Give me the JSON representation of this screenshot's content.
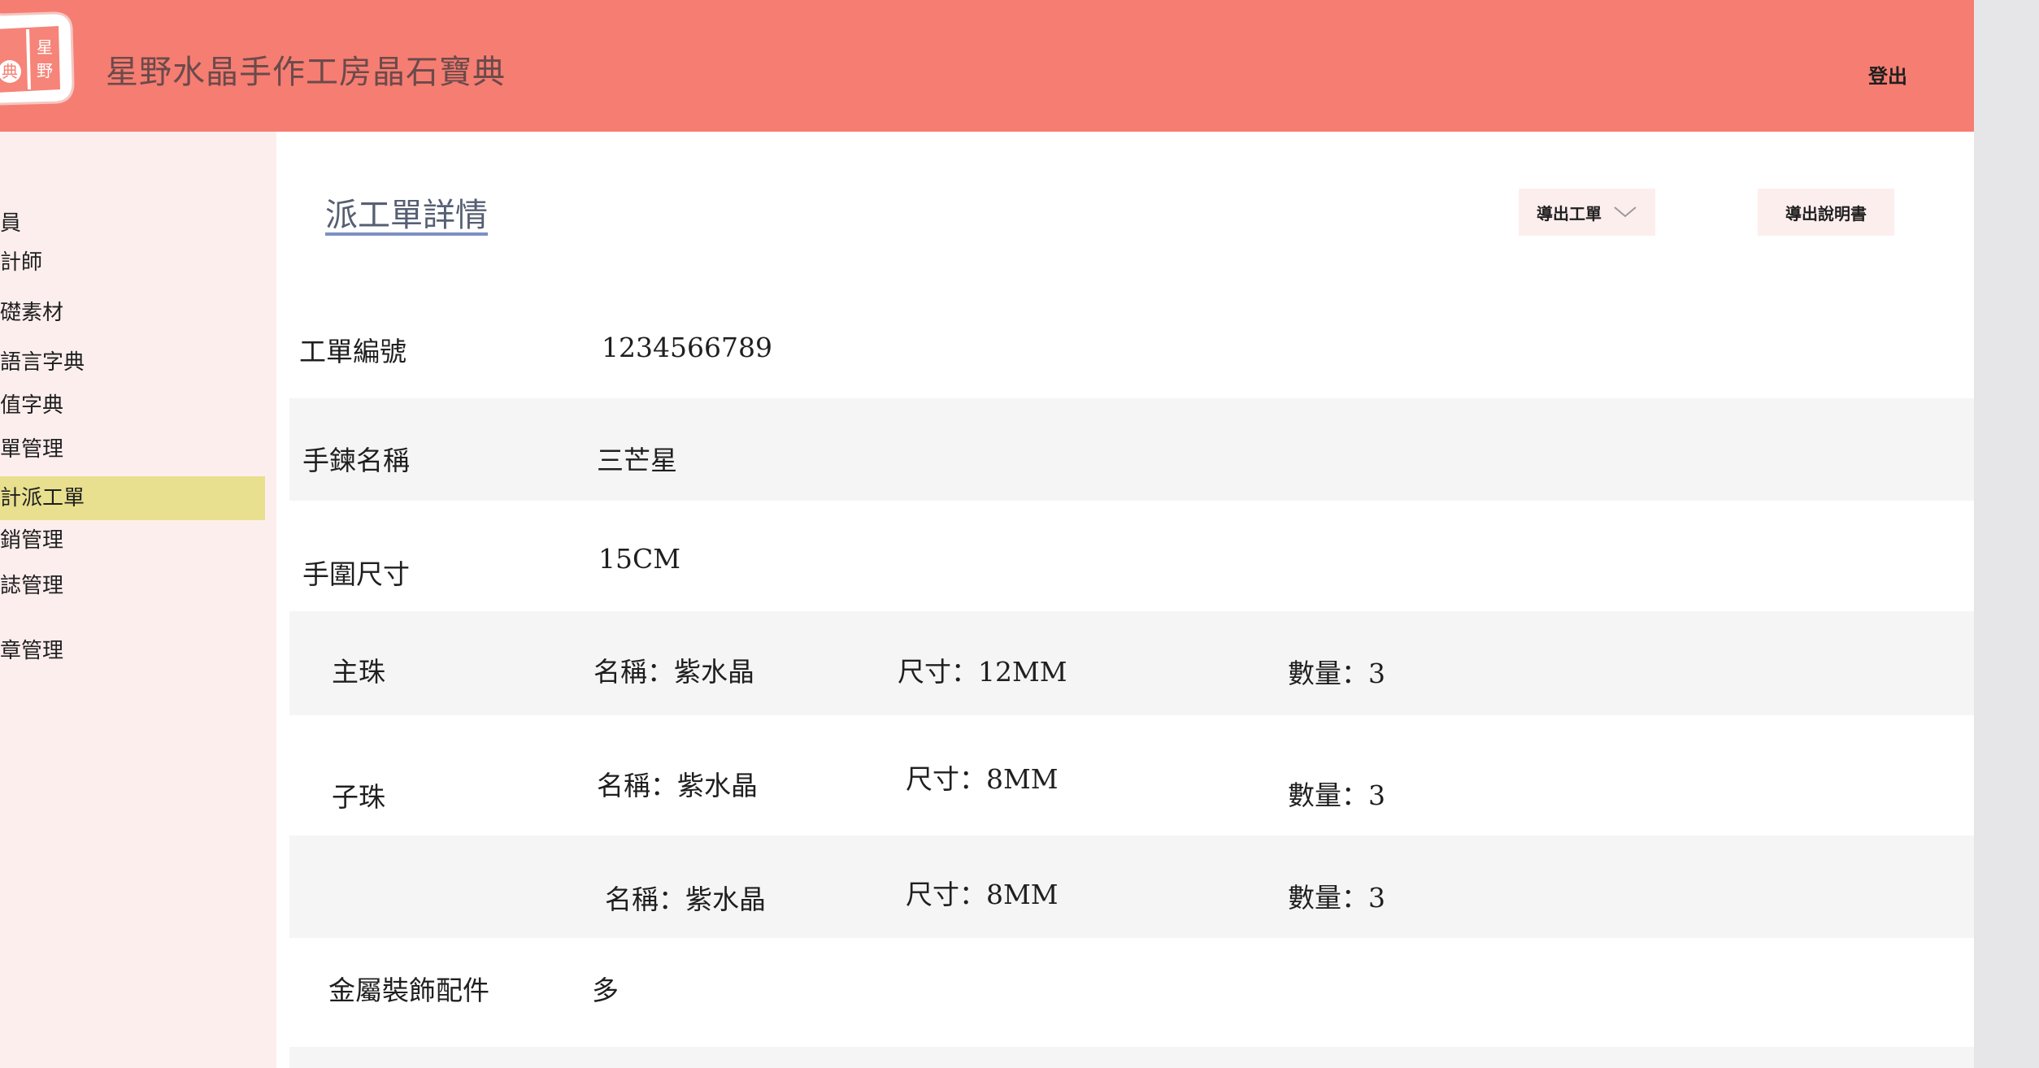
{
  "header": {
    "title": "星野水晶手作工房晶石寶典",
    "logout_label": "登出",
    "logo": {
      "icon": "seal-stamp-icon",
      "text_left": "典",
      "text_right_top": "星",
      "text_right_bottom": "野"
    }
  },
  "sidebar": {
    "items": [
      {
        "label": "員",
        "active": false
      },
      {
        "label": "計師",
        "active": false
      },
      {
        "label": "礎素材",
        "active": false
      },
      {
        "label": "語言字典",
        "active": false
      },
      {
        "label": "值字典",
        "active": false
      },
      {
        "label": "單管理",
        "active": false
      },
      {
        "label": "計派工單",
        "active": true
      },
      {
        "label": "銷管理",
        "active": false
      },
      {
        "label": "誌管理",
        "active": false
      },
      {
        "label": "章管理",
        "active": false
      }
    ]
  },
  "main": {
    "page_title": "派工單詳情",
    "buttons": {
      "export_order": "導出工單",
      "export_manual": "導出說明書"
    },
    "fields": {
      "order_no": {
        "label": "工單編號",
        "value": "1234566789"
      },
      "bracelet_name": {
        "label": "手鍊名稱",
        "value": "三芒星"
      },
      "wrist_size": {
        "label": "手圍尺寸",
        "value": "15CM"
      },
      "metal": {
        "label": "金屬裝飾配件",
        "value": "多"
      }
    },
    "beads": [
      {
        "label": "主珠",
        "name": "名稱：紫水晶",
        "size": "尺寸：12MM",
        "qty": "數量：3"
      },
      {
        "label": "子珠",
        "name": "名稱：紫水晶",
        "size": "尺寸：8MM",
        "qty": "數量：3"
      },
      {
        "label": "",
        "name": "名稱：紫水晶",
        "size": "尺寸：8MM",
        "qty": "數量：3"
      }
    ]
  },
  "colors": {
    "header_bg": "#f67d72",
    "sidebar_bg": "#fdeeee",
    "active_item_bg": "#e8df8f",
    "alt_row_bg": "#f5f5f5",
    "button_bg": "#fdeeee"
  }
}
